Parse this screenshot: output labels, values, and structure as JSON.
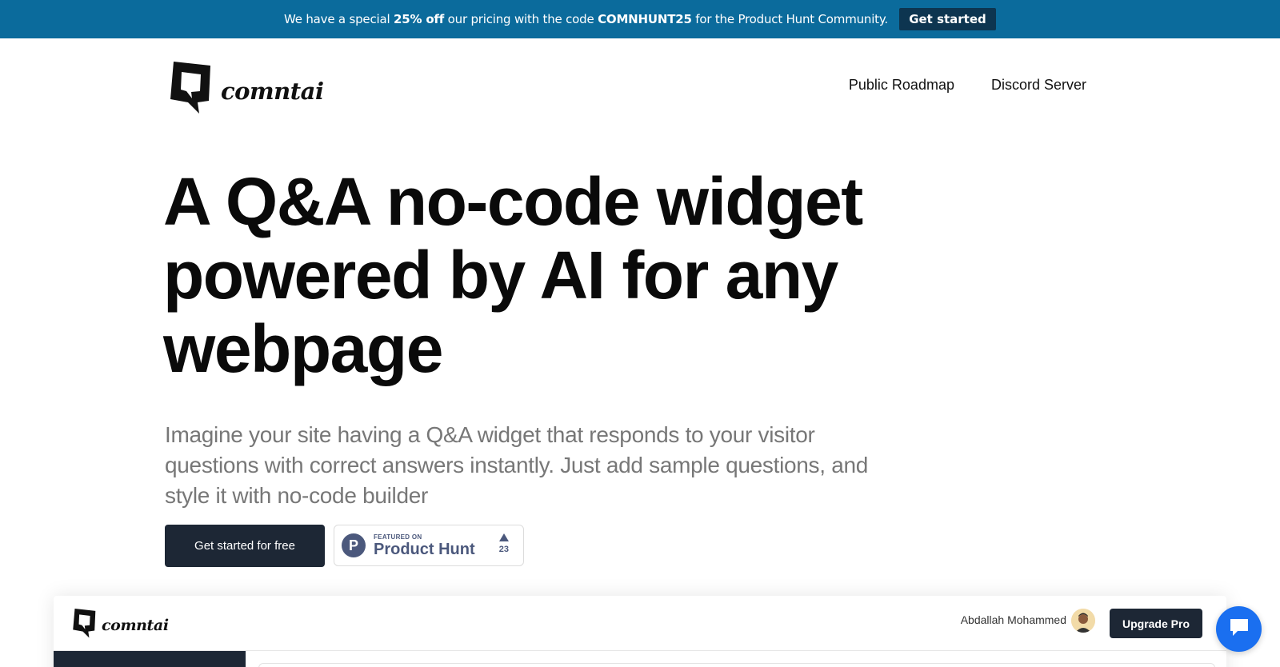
{
  "promo": {
    "text_1": "We have a special ",
    "discount": "25% off",
    "text_2": " our pricing with the code ",
    "code": "COMNHUNT25",
    "text_3": " for the Product Hunt Community.",
    "button_label": "Get started",
    "bg_color": "#0b6b9c"
  },
  "header": {
    "logo_icon": "speech-bubble-logo-icon",
    "logo_text": "comntai",
    "nav": [
      {
        "label": "Public Roadmap"
      },
      {
        "label": "Discord Server"
      }
    ]
  },
  "hero": {
    "title_line_1": "A Q&A no-code widget",
    "title_line_2": "powered by AI for any",
    "title_line_3": "webpage",
    "subtitle": "Imagine your site having a Q&A widget that responds to your visitor questions with correct answers instantly. Just add sample questions, and style it with no-code builder",
    "cta_label": "Get started for free"
  },
  "product_hunt": {
    "logo_letter": "P",
    "small_label": "FEATURED ON",
    "big_label": "Product Hunt",
    "votes": "23",
    "color": "#4b587c"
  },
  "preview": {
    "logo_text": "comntai",
    "user_name": "Abdallah Mohammed",
    "upgrade_label": "Upgrade Pro"
  },
  "chat": {
    "icon": "chat-bubble-icon",
    "color": "#1a6ff0"
  }
}
